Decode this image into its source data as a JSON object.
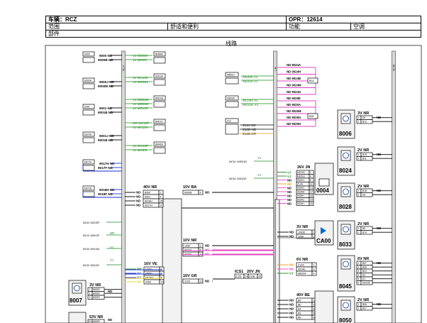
{
  "header": {
    "vehicle": "车辆：RCZ",
    "opr": "OPR：12614",
    "range_label": "范围",
    "range_value": "舒适和便利",
    "function_label": "功能",
    "function_value": "空调",
    "part_label": "部件"
  },
  "diagram": {
    "title": "线路",
    "rail_left": "5C V",
    "rail_mid": "1 M",
    "rail_right": "5C 5F",
    "left_blocks": [
      {
        "tag": "E500",
        "l1": "9000 ND",
        "l2": "9000B ND"
      },
      {
        "tag": "E600A",
        "l1": "9000J ND",
        "l2": "9000M ND"
      },
      {
        "tag": "E601",
        "l1": "9001 ND",
        "l2": "9001B ND"
      },
      {
        "tag": "E670A",
        "l1": "9001J ND",
        "l2": "9001B ND"
      },
      {
        "tag": "E872A",
        "l1": "9017H ND",
        "l2": "9017F ND"
      },
      {
        "tag": "E872B",
        "l1": "9018H ND",
        "l2": "9018F ND"
      }
    ],
    "mid_blocks": [
      {
        "tag": "BM808",
        "l1": "VJ ME08A",
        "l2": "VJ ME08I"
      },
      {
        "tag": "EM10A",
        "l1": "VJ MC100",
        "l2": "VJ MES81"
      },
      {
        "tag": "BM10B",
        "l1": "VJ MB5M2",
        "l2": "VJ MB5M3",
        "l3": "VJ ME10P"
      },
      {
        "tag": "BM10C",
        "l1": "NR MC10P",
        "l2": "VJ MC100"
      },
      {
        "tag": "BM40A",
        "l1": "VJ MC40P",
        "l2": "VJ MC80I"
      }
    ],
    "right_blocks": [
      {
        "tag": "MB01C",
        "l1": "ME806 VJ",
        "l2": "ME818 VJ"
      },
      {
        "tag": "MB03D",
        "l1": "MC004 VJ",
        "l2": "MC51E VJ"
      }
    ],
    "z12": [
      "Z12A ND",
      "Z12D ND",
      "Z12B OR"
    ],
    "z12_tag": "Z12",
    "nd_group1": [
      "ND 9024A",
      "ND 9024H",
      "ND 9024B",
      "ND 9024M",
      "ND 9024G"
    ],
    "nd_group2": [
      "ND 9025E",
      "ND 9025A",
      "ND 9025M",
      "ND 9025G",
      "ND 9025H"
    ],
    "box_b24": "B24",
    "box_b25": "B25",
    "mc_labels": [
      "MC51 1MES1B",
      "MC61 1MC61E"
    ],
    "vj": "VJ",
    "left_small": [
      {
        "tag": "MC40",
        "text": "1MC40P"
      },
      {
        "tag": "MC10",
        "text": "1ME10P"
      },
      {
        "tag": "MC40",
        "text": "1MC40A"
      },
      {
        "tag": "MC40",
        "text": "1MC40C"
      }
    ],
    "wire_color_nr": "NR",
    "wire_color_vj": "VJ",
    "conn_40v": {
      "title": "40V NR",
      "rows": [
        "8000",
        "9001",
        "8018H",
        "9017H"
      ],
      "pins": [
        "2",
        "4",
        "35",
        "37"
      ],
      "wires": [
        "ND",
        "ND",
        "ND",
        "ND"
      ]
    },
    "conn_10v_ba": {
      "title": "10V BA",
      "rows": [
        "8060B"
      ],
      "pins": [
        "4"
      ],
      "wire": "ND"
    },
    "conn_16v_ve": {
      "title": "16V VE",
      "rows": [
        "CM10",
        "ME50",
        "MC80I",
        "2083"
      ],
      "pins": [
        "1",
        "3",
        "8",
        "16"
      ],
      "wires": [
        "NR",
        "VJ",
        "VJ",
        "ND"
      ]
    },
    "conn_10v_nr": {
      "title": "10V NR",
      "rows": [
        "1050",
        "9024A",
        "9025A"
      ],
      "pins": [
        "3",
        "8",
        "10"
      ],
      "wires": [
        "ND",
        "ND",
        "ND"
      ]
    },
    "conn_16v_gr": {
      "title": "16V GR",
      "rows": [
        "Z120"
      ],
      "pins": [
        "11"
      ],
      "wire": "ND"
    },
    "conn_ics1": {
      "title": "ICS1",
      "wire": "ND"
    },
    "conn_20v_jn": {
      "title": "20V JN",
      "rows": [
        "Z12D",
        "Z12B"
      ],
      "pins": [
        "14",
        "15"
      ]
    },
    "conn_26v_jn": {
      "title": "26V JN",
      "rows": [
        "MC004",
        "ME51E",
        "9024H",
        "Z12A",
        "9025G",
        "9024M",
        "9025H",
        "9024G",
        "9024H"
      ],
      "pins": [
        "1",
        "4",
        "5",
        "11",
        "14",
        "17",
        "18",
        "19",
        "20"
      ],
      "wires": [
        "VJ",
        "VJ",
        "ND",
        "OR",
        "ND",
        "ND",
        "ND",
        "ND",
        "ND"
      ]
    },
    "conn_3v_nr_mid": {
      "title": "3V NR",
      "rows": [
        "1083E",
        "1050"
      ],
      "pins": [
        "1",
        "2"
      ],
      "wires": [
        "ND",
        "ND"
      ]
    },
    "conn_6v_nr": {
      "title": "6V NR",
      "rows": [
        "Z12A",
        "9024E",
        "ME004"
      ],
      "pins": [
        "1",
        "3",
        "4"
      ],
      "wires": [
        "ND",
        "ND",
        "VJ"
      ]
    },
    "conn_40v_be": {
      "title": "40V BE",
      "rows": [
        "B0",
        "B0",
        "B4",
        "B5",
        "B6"
      ],
      "pins": [
        "1",
        "3",
        "4",
        "5",
        "8"
      ],
      "wires": [
        "ND",
        "ND",
        "ND",
        "ND",
        "ND"
      ]
    },
    "comp_0004": "0004",
    "comp_ca00": "CA00",
    "right_components": [
      {
        "id": "8006",
        "title": "3V NR",
        "rows": [
          [
            "1",
            "D9"
          ],
          [
            "2",
            "B12"
          ]
        ],
        "wire": "ND"
      },
      {
        "id": "8024",
        "title": "2V NR",
        "rows": [
          [
            "1",
            "B19"
          ],
          [
            "2",
            "B11"
          ]
        ],
        "wire": "ND"
      },
      {
        "id": "8028",
        "title": "2V NR",
        "rows": [
          [
            "1",
            "B18"
          ],
          [
            "2",
            "D4"
          ]
        ],
        "wire": "ND"
      },
      {
        "id": "8033",
        "title": "2V NR",
        "rows": [
          [
            "1",
            "B5"
          ],
          [
            "2",
            "B14"
          ]
        ],
        "wire": "ND"
      },
      {
        "id": "8045",
        "title": "6V NR",
        "rows": [
          [
            "1",
            "B07"
          ],
          [
            "2",
            "B08"
          ],
          [
            "3",
            "B04"
          ],
          [
            "4",
            "A2"
          ],
          [
            "5",
            "A1"
          ],
          [
            "6",
            "MC008"
          ]
        ],
        "wire": "ND"
      },
      {
        "id": "8050",
        "title": "2V NR",
        "rows": [
          [
            "1",
            "B06"
          ],
          [
            "2",
            "B07"
          ]
        ],
        "wire": "ND"
      }
    ],
    "comp_8007": {
      "id": "8007",
      "title": "3V NR",
      "rows": [
        [
          "1",
          "8092R"
        ],
        [
          "2",
          "8092R"
        ],
        [
          "3",
          "8092R"
        ]
      ],
      "wire": "ND"
    },
    "comp_bottom": {
      "title": "53V NR",
      "rows": [
        [
          "21",
          "8092R"
        ]
      ],
      "wire": "ND"
    }
  }
}
